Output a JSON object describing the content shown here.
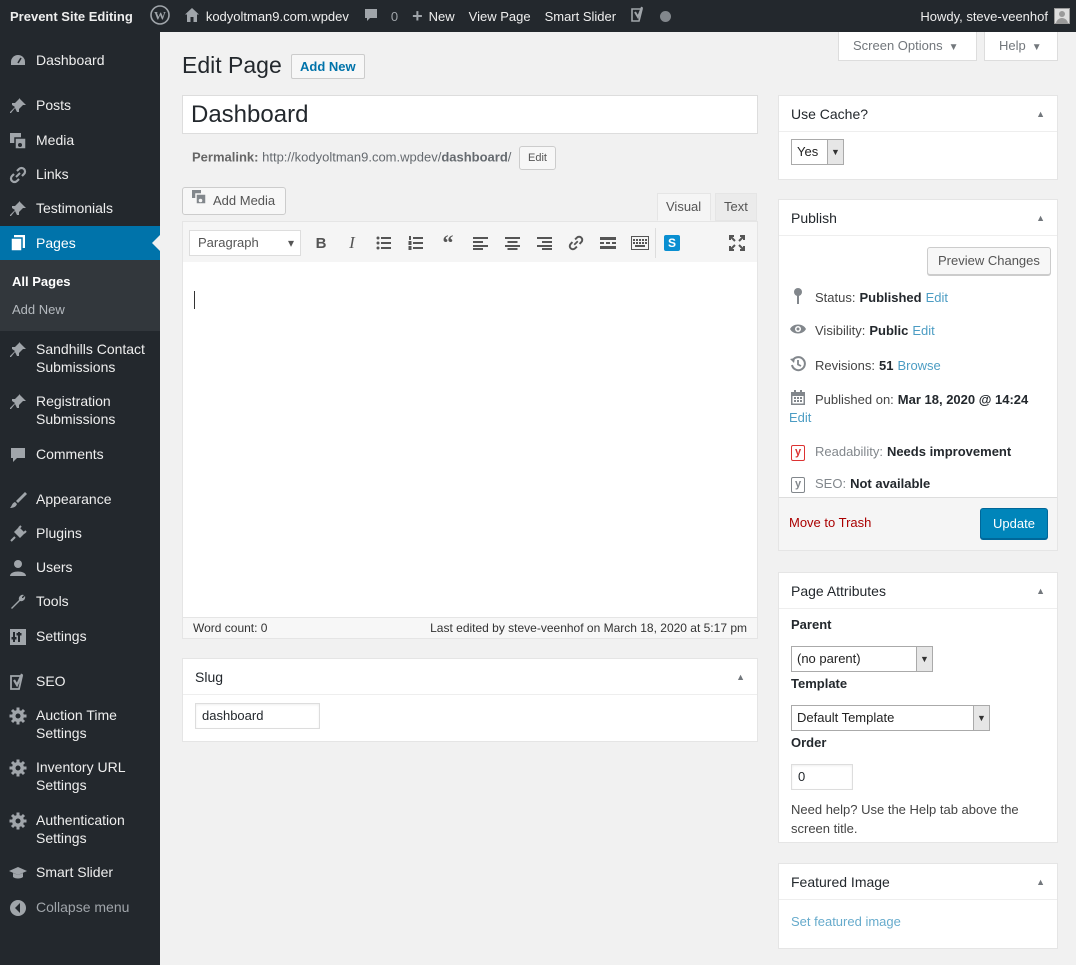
{
  "adminbar": {
    "site_name": "Prevent Site Editing",
    "site_url_label": "kodyoltman9.com.wpdev",
    "comments_count": "0",
    "new_label": "New",
    "view_page_label": "View Page",
    "smart_slider_label": "Smart Slider",
    "howdy_label": "Howdy, steve-veenhof"
  },
  "sidebar": {
    "items": [
      {
        "label": "Dashboard",
        "icon": "dashboard-icon"
      },
      {
        "label": "Posts",
        "icon": "pin-icon"
      },
      {
        "label": "Media",
        "icon": "media-icon"
      },
      {
        "label": "Links",
        "icon": "link-icon"
      },
      {
        "label": "Testimonials",
        "icon": "pin-icon"
      },
      {
        "label": "Pages",
        "icon": "pages-icon"
      },
      {
        "label": "Sandhills Contact Submissions",
        "icon": "pin-icon"
      },
      {
        "label": "Registration Submissions",
        "icon": "pin-icon"
      },
      {
        "label": "Comments",
        "icon": "comment-icon"
      },
      {
        "label": "Appearance",
        "icon": "brush-icon"
      },
      {
        "label": "Plugins",
        "icon": "plugin-icon"
      },
      {
        "label": "Users",
        "icon": "user-icon"
      },
      {
        "label": "Tools",
        "icon": "wrench-icon"
      },
      {
        "label": "Settings",
        "icon": "settings-icon"
      },
      {
        "label": "SEO",
        "icon": "yoast-icon"
      },
      {
        "label": "Auction Time Settings",
        "icon": "gear-icon"
      },
      {
        "label": "Inventory URL Settings",
        "icon": "gear-icon"
      },
      {
        "label": "Authentication Settings",
        "icon": "gear-icon"
      },
      {
        "label": "Smart Slider",
        "icon": "graduation-cap-icon"
      },
      {
        "label": "Collapse menu",
        "icon": "collapse-icon"
      }
    ],
    "submenu": [
      "All Pages",
      "Add New"
    ]
  },
  "header": {
    "title": "Edit Page",
    "add_new": "Add New",
    "screen_options": "Screen Options",
    "help": "Help"
  },
  "editor": {
    "title_value": "Dashboard",
    "permalink_label": "Permalink:",
    "permalink_url": "http://kodyoltman9.com.wpdev/",
    "permalink_slug": "dashboard",
    "permalink_end": "/",
    "permalink_edit": "Edit",
    "add_media": "Add Media",
    "tab_visual": "Visual",
    "tab_text": "Text",
    "format_select": "Paragraph",
    "word_count": "Word count: 0",
    "last_edited": "Last edited by steve-veenhof on March 18, 2020 at 5:17 pm"
  },
  "slug_box": {
    "title": "Slug",
    "value": "dashboard"
  },
  "cache_box": {
    "title": "Use Cache?",
    "value": "Yes"
  },
  "publish": {
    "title": "Publish",
    "preview": "Preview Changes",
    "status_label": "Status:",
    "status_value": "Published",
    "visibility_label": "Visibility:",
    "visibility_value": "Public",
    "revisions_label": "Revisions:",
    "revisions_value": "51",
    "browse": "Browse",
    "published_on_label": "Published on:",
    "published_on_value": "Mar 18, 2020 @ 14:24",
    "edit": "Edit",
    "readability_label": "Readability:",
    "readability_value": "Needs improvement",
    "seo_label": "SEO:",
    "seo_value": "Not available",
    "trash": "Move to Trash",
    "update": "Update"
  },
  "attributes": {
    "title": "Page Attributes",
    "parent_label": "Parent",
    "parent_value": "(no parent)",
    "template_label": "Template",
    "template_value": "Default Template",
    "order_label": "Order",
    "order_value": "0",
    "help": "Need help? Use the Help tab above the screen title."
  },
  "featured": {
    "title": "Featured Image",
    "link": "Set featured image"
  },
  "colors": {
    "admin_dark": "#23282d",
    "accent": "#0073aa",
    "primary_button": "#0085ba",
    "trash": "#a00"
  }
}
